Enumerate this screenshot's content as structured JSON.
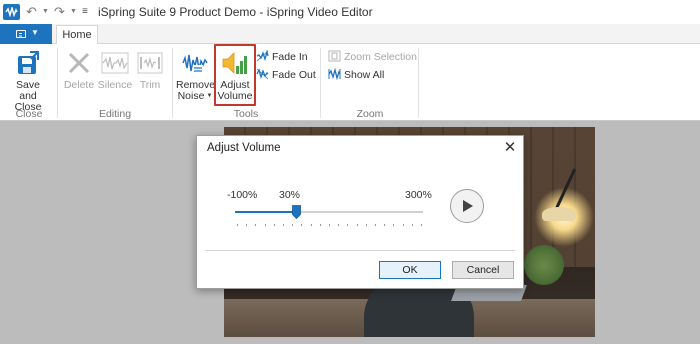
{
  "window": {
    "title": "iSpring Suite 9 Product Demo - iSpring Video Editor"
  },
  "quick_access": {
    "undo_icon": "undo-icon",
    "redo_icon": "redo-icon",
    "customize_icon": "customize-quick-access-icon"
  },
  "tabs": [
    {
      "label": "Home",
      "active": true
    }
  ],
  "ribbon": {
    "groups": [
      {
        "label": "Close",
        "buttons": [
          {
            "label_line1": "Save and",
            "label_line2": "Close",
            "icon": "save-close-icon",
            "enabled": true
          }
        ]
      },
      {
        "label": "Editing",
        "buttons": [
          {
            "label": "Delete",
            "icon": "delete-icon",
            "enabled": false
          },
          {
            "label": "Silence",
            "icon": "silence-icon",
            "enabled": false
          },
          {
            "label": "Trim",
            "icon": "trim-icon",
            "enabled": false
          }
        ]
      },
      {
        "label": "Tools",
        "buttons": [
          {
            "label_line1": "Remove",
            "label_line2": "Noise",
            "icon": "remove-noise-icon",
            "enabled": true,
            "has_dropdown": true
          },
          {
            "label_line1": "Adjust",
            "label_line2": "Volume",
            "icon": "adjust-volume-icon",
            "enabled": true,
            "highlighted": true
          },
          {
            "label": "Fade In",
            "icon": "fade-in-icon",
            "enabled": true
          },
          {
            "label": "Fade Out",
            "icon": "fade-out-icon",
            "enabled": true
          }
        ]
      },
      {
        "label": "Zoom",
        "buttons": [
          {
            "label": "Zoom Selection",
            "icon": "zoom-selection-icon",
            "enabled": false
          },
          {
            "label": "Show All",
            "icon": "show-all-icon",
            "enabled": true
          }
        ]
      }
    ]
  },
  "dialog": {
    "title": "Adjust Volume",
    "min_label": "-100%",
    "current_label": "30%",
    "max_label": "300%",
    "slider": {
      "min": -100,
      "max": 300,
      "value": 30
    },
    "ok_label": "OK",
    "cancel_label": "Cancel"
  },
  "colors": {
    "accent": "#1e73be",
    "highlight_border": "#c0392b",
    "workspace_bg": "#bcbcbc"
  }
}
